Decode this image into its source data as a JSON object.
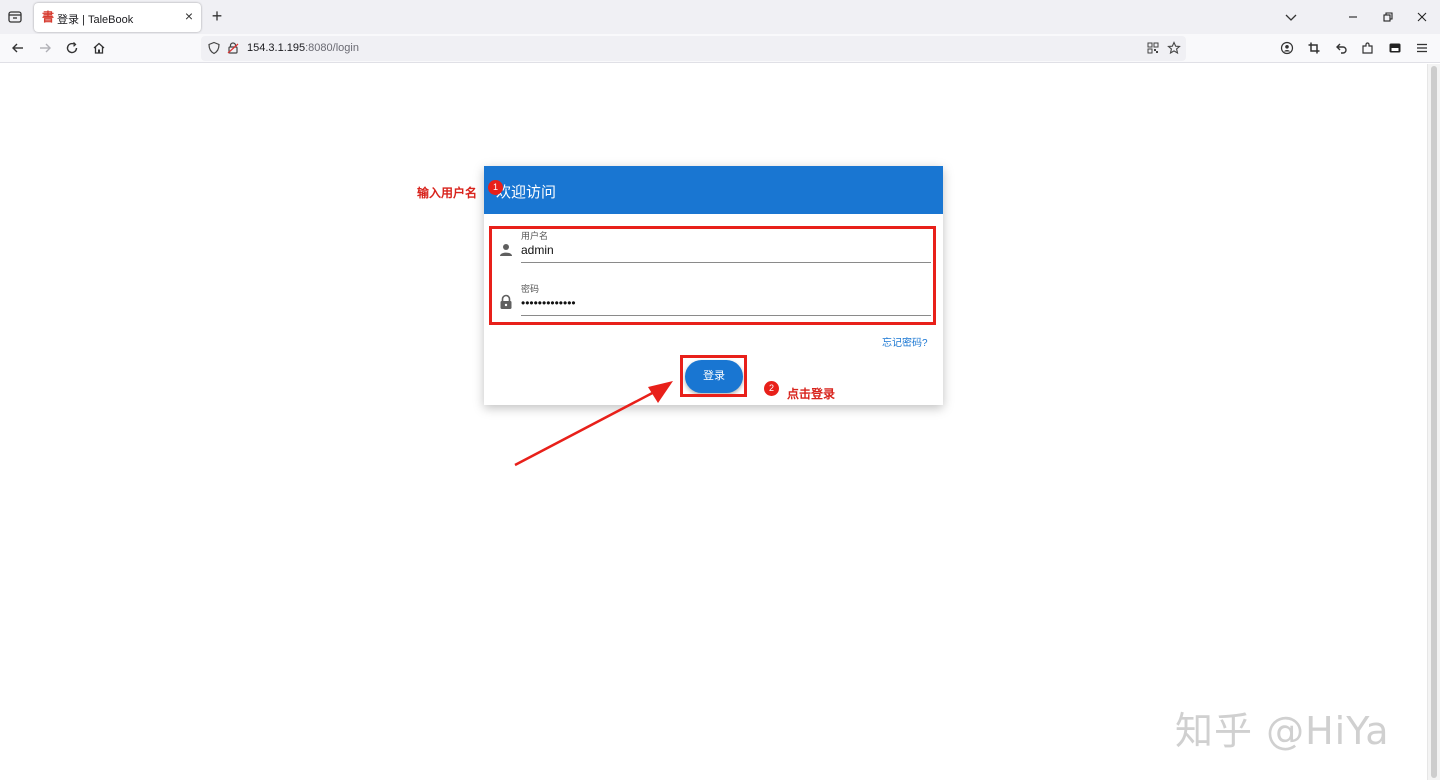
{
  "browser": {
    "tab_title": "登录 | TaleBook",
    "tab_favicon": "書",
    "tab_close": "×",
    "new_tab": "+",
    "url_host": "154.3.1.195",
    "url_path": ":8080/login"
  },
  "login": {
    "title": "欢迎访问",
    "username_label": "用户名",
    "username_value": "admin",
    "password_label": "密码",
    "password_value": "•••••••••••••",
    "forgot_link": "忘记密码?",
    "submit_label": "登录"
  },
  "annotations": {
    "step1_text": "输入用户名",
    "step1_num": "1",
    "step2_text": "点击登录",
    "step2_num": "2",
    "color": "#e8201a"
  },
  "watermark": "知乎 @HiYa",
  "colors": {
    "primary": "#1976d2"
  }
}
